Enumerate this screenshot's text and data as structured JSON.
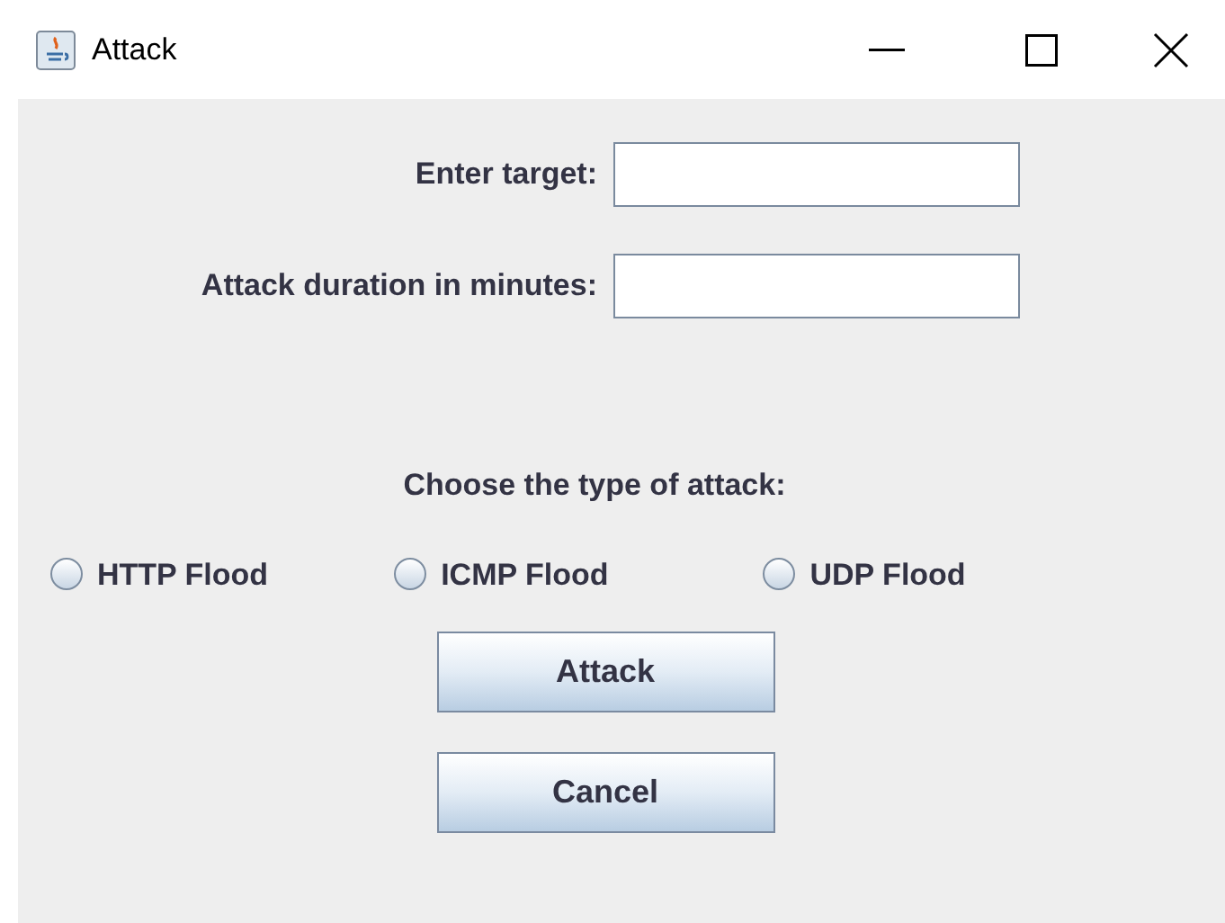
{
  "window": {
    "title": "Attack"
  },
  "fields": [
    {
      "label": "Enter target:"
    },
    {
      "label": "Attack duration in minutes:"
    }
  ],
  "attack_type": {
    "heading": "Choose the type of attack:",
    "options": [
      {
        "label": "HTTP Flood",
        "selected": false
      },
      {
        "label": "ICMP Flood",
        "selected": false
      },
      {
        "label": "UDP Flood",
        "selected": false
      }
    ]
  },
  "buttons": [
    "Attack",
    "Cancel"
  ]
}
